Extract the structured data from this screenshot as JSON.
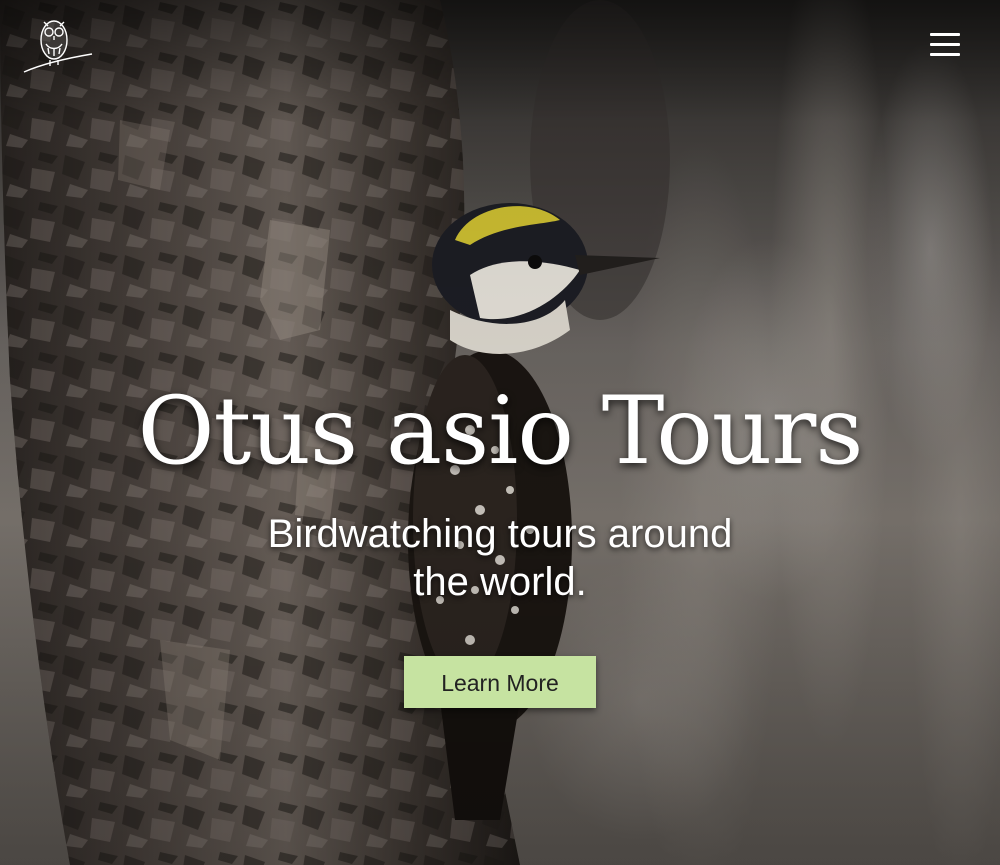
{
  "site": {
    "title": "Otus asio Tours",
    "subtitle": "Birdwatching tours around the world.",
    "cta_label": "Learn More"
  },
  "header": {
    "logo_icon": "owl-logo-icon",
    "menu_icon": "hamburger-menu-icon"
  },
  "colors": {
    "cta_background": "#c6e3a1",
    "cta_text": "#222222",
    "heading_text": "#ffffff"
  }
}
